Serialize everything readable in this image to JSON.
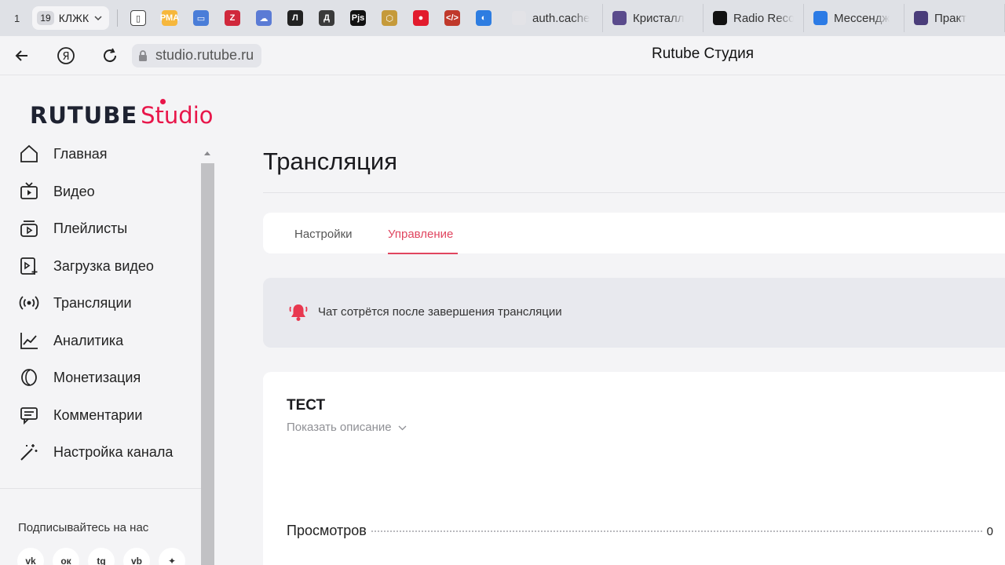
{
  "browser": {
    "workspace_count": "1",
    "current_group": {
      "count": "19",
      "label": "КЛЖК"
    },
    "pinned": [
      {
        "name": "file-icon",
        "color": "#ffffff",
        "glyph": "▯"
      },
      {
        "name": "rma-icon",
        "color": "#f6b73c",
        "glyph": "РМА"
      },
      {
        "name": "folder-icon",
        "color": "#4a7dd8",
        "glyph": "▭"
      },
      {
        "name": "zen-icon",
        "color": "#d0283c",
        "glyph": "Z"
      },
      {
        "name": "cloud-icon",
        "color": "#5b7bd5",
        "glyph": "☁"
      },
      {
        "name": "l-icon",
        "color": "#222222",
        "glyph": "Л"
      },
      {
        "name": "d-icon",
        "color": "#3a3a3a",
        "glyph": "Д"
      },
      {
        "name": "pjs-icon",
        "color": "#111111",
        "glyph": "Pjs"
      },
      {
        "name": "hex-icon",
        "color": "#c59a3a",
        "glyph": "⬡"
      },
      {
        "name": "drop-icon",
        "color": "#e21b2d",
        "glyph": "●"
      },
      {
        "name": "code-icon",
        "color": "#c0392b",
        "glyph": "</>"
      },
      {
        "name": "color-icon",
        "color": "#2e7de1",
        "glyph": "◐"
      }
    ],
    "tabs": [
      {
        "label": "auth.cache",
        "color": "#e3e3e7"
      },
      {
        "label": "Кристалл",
        "color": "#5a4b8c"
      },
      {
        "label": "Radio Reco",
        "color": "#111111"
      },
      {
        "label": "Мессендж",
        "color": "#2c7be5"
      },
      {
        "label": "Практ",
        "color": "#4a3d7a"
      }
    ],
    "url": "studio.rutube.ru",
    "page_title": "Rutube Студия"
  },
  "logo": {
    "brand": "RUTUBE",
    "product": "Studio",
    "accent": "#e8164a"
  },
  "sidebar": {
    "items": [
      {
        "label": "Главная",
        "icon": "home-icon"
      },
      {
        "label": "Видео",
        "icon": "video-icon"
      },
      {
        "label": "Плейлисты",
        "icon": "playlist-icon"
      },
      {
        "label": "Загрузка видео",
        "icon": "upload-video-icon"
      },
      {
        "label": "Трансляции",
        "icon": "broadcast-icon"
      },
      {
        "label": "Аналитика",
        "icon": "analytics-icon"
      },
      {
        "label": "Монетизация",
        "icon": "monetization-icon"
      },
      {
        "label": "Комментарии",
        "icon": "comments-icon"
      },
      {
        "label": "Настройка канала",
        "icon": "channel-settings-icon"
      }
    ],
    "follow_label": "Подписывайтесь на нас",
    "socials": [
      {
        "name": "vk-icon",
        "glyph": "vk"
      },
      {
        "name": "ok-icon",
        "glyph": "ок"
      },
      {
        "name": "telegram-icon",
        "glyph": "tg"
      },
      {
        "name": "viber-icon",
        "glyph": "vb"
      },
      {
        "name": "zen-social-icon",
        "glyph": "✦"
      }
    ]
  },
  "main": {
    "title": "Трансляция",
    "tabs": [
      {
        "label": "Настройки",
        "active": false
      },
      {
        "label": "Управление",
        "active": true
      }
    ],
    "notice": "Чат сотрётся после завершения трансляции",
    "stream": {
      "title": "ТЕСТ",
      "show_description": "Показать описание",
      "stats": [
        {
          "label": "Просмотров",
          "value": "0"
        }
      ]
    }
  },
  "colors": {
    "accent": "#e0455f",
    "notice_bg": "#e8e9ee",
    "bell": "#e8384f"
  }
}
